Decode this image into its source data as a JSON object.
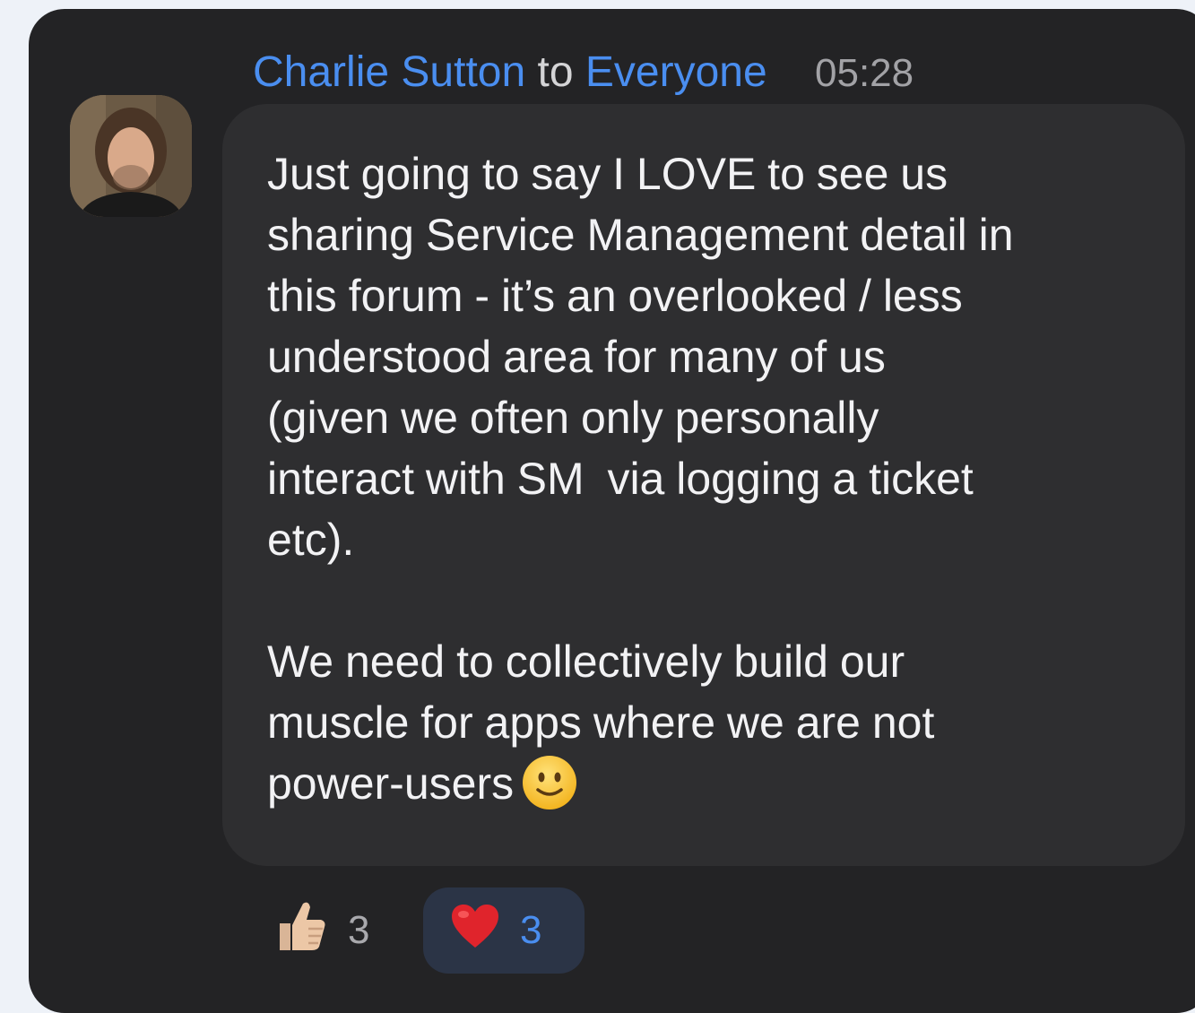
{
  "message": {
    "sender": "Charlie Sutton",
    "to_word": "to",
    "recipient": "Everyone",
    "time": "05:28",
    "body_p1": "Just going to say I LOVE to see us\nsharing Service Management detail in\nthis forum - it’s an overlooked / less\nunderstood area for many of us\n(given we often only personally\ninteract with SM  via logging a ticket\netc).",
    "body_p2": "We need to collectively build our\nmuscle for apps where we are not\npower-users",
    "emoji_icon": "slightly-smiling-face-icon"
  },
  "reactions": [
    {
      "icon": "thumbs-up-icon",
      "count": "3",
      "selected": false
    },
    {
      "icon": "red-heart-icon",
      "count": "3",
      "selected": true
    }
  ],
  "colors": {
    "panel": "#232325",
    "bubble": "#2e2e30",
    "accent": "#4a8ef0",
    "text": "#f2f2f4"
  }
}
